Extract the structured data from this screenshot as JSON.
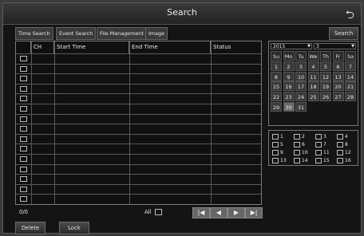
{
  "window": {
    "title": "Search"
  },
  "tabs": [
    "Time Search",
    "Event Search",
    "File Management",
    "Image"
  ],
  "search_button": "Search",
  "table": {
    "headers": [
      "",
      "CH",
      "Start Time",
      "End Time",
      "Status"
    ]
  },
  "footer": {
    "count": "0/0",
    "all_label": "All",
    "nav": [
      "|◀",
      "◀",
      "▶",
      "▶|"
    ]
  },
  "calendar": {
    "year": "2015",
    "month": "3",
    "weekdays": [
      "Su",
      "Mo",
      "Tu",
      "We",
      "Th",
      "Fr",
      "Sa"
    ],
    "days": [
      "1",
      "2",
      "3",
      "4",
      "5",
      "6",
      "7",
      "8",
      "9",
      "10",
      "11",
      "12",
      "13",
      "14",
      "15",
      "16",
      "17",
      "18",
      "19",
      "20",
      "21",
      "22",
      "23",
      "24",
      "25",
      "26",
      "27",
      "28",
      "29",
      "30",
      "31"
    ],
    "selected_day": "30"
  },
  "channels": [
    "1",
    "2",
    "3",
    "4",
    "5",
    "6",
    "7",
    "8",
    "9",
    "10",
    "11",
    "12",
    "13",
    "14",
    "15",
    "16"
  ],
  "buttons": {
    "delete": "Delete",
    "lock": "Lock"
  }
}
